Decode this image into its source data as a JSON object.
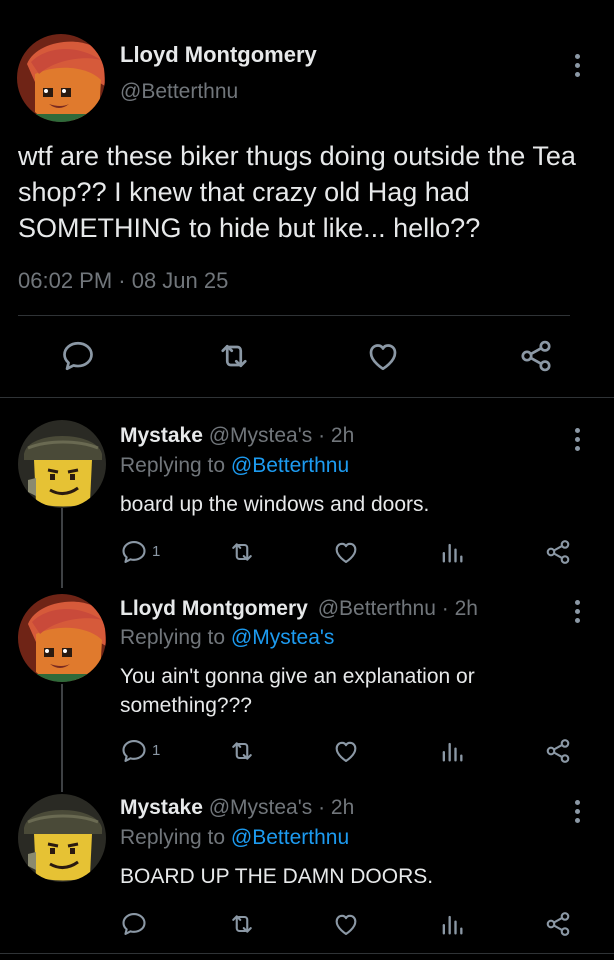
{
  "main_tweet": {
    "author_name": "Lloyd Montgomery",
    "handle": "@Betterthnu",
    "text": "wtf are these biker thugs doing outside the Tea shop?? I knew that crazy old Hag had SOMETHING to hide but like... hello??",
    "timestamp": "06:02 PM · 08 Jun 25"
  },
  "replies": [
    {
      "author_name": "Mystake",
      "handle_time": "@Mystea's · 2h",
      "replying_prefix": "Replying to",
      "replying_to": "@Betterthnu",
      "text": "board up the windows and doors.",
      "reply_count": "1"
    },
    {
      "author_name": "Lloyd Montgomery",
      "handle_time": "@Betterthnu · 2h",
      "replying_prefix": "Replying to",
      "replying_to": "@Mystea's",
      "text": "You ain't gonna give an explanation or something???",
      "reply_count": "1"
    },
    {
      "author_name": "Mystake",
      "handle_time": "@Mystea's · 2h",
      "replying_prefix": "Replying to",
      "replying_to": "@Betterthnu",
      "text": "BOARD UP THE DAMN DOORS.",
      "reply_count": ""
    }
  ],
  "colors": {
    "background": "#000000",
    "text": "#e7e9ea",
    "secondary": "#71767b",
    "accent": "#1d9bf0",
    "divider": "#2f3336"
  },
  "icons": [
    "comment-icon",
    "retweet-icon",
    "heart-icon",
    "share-icon",
    "analytics-icon",
    "more-icon"
  ]
}
